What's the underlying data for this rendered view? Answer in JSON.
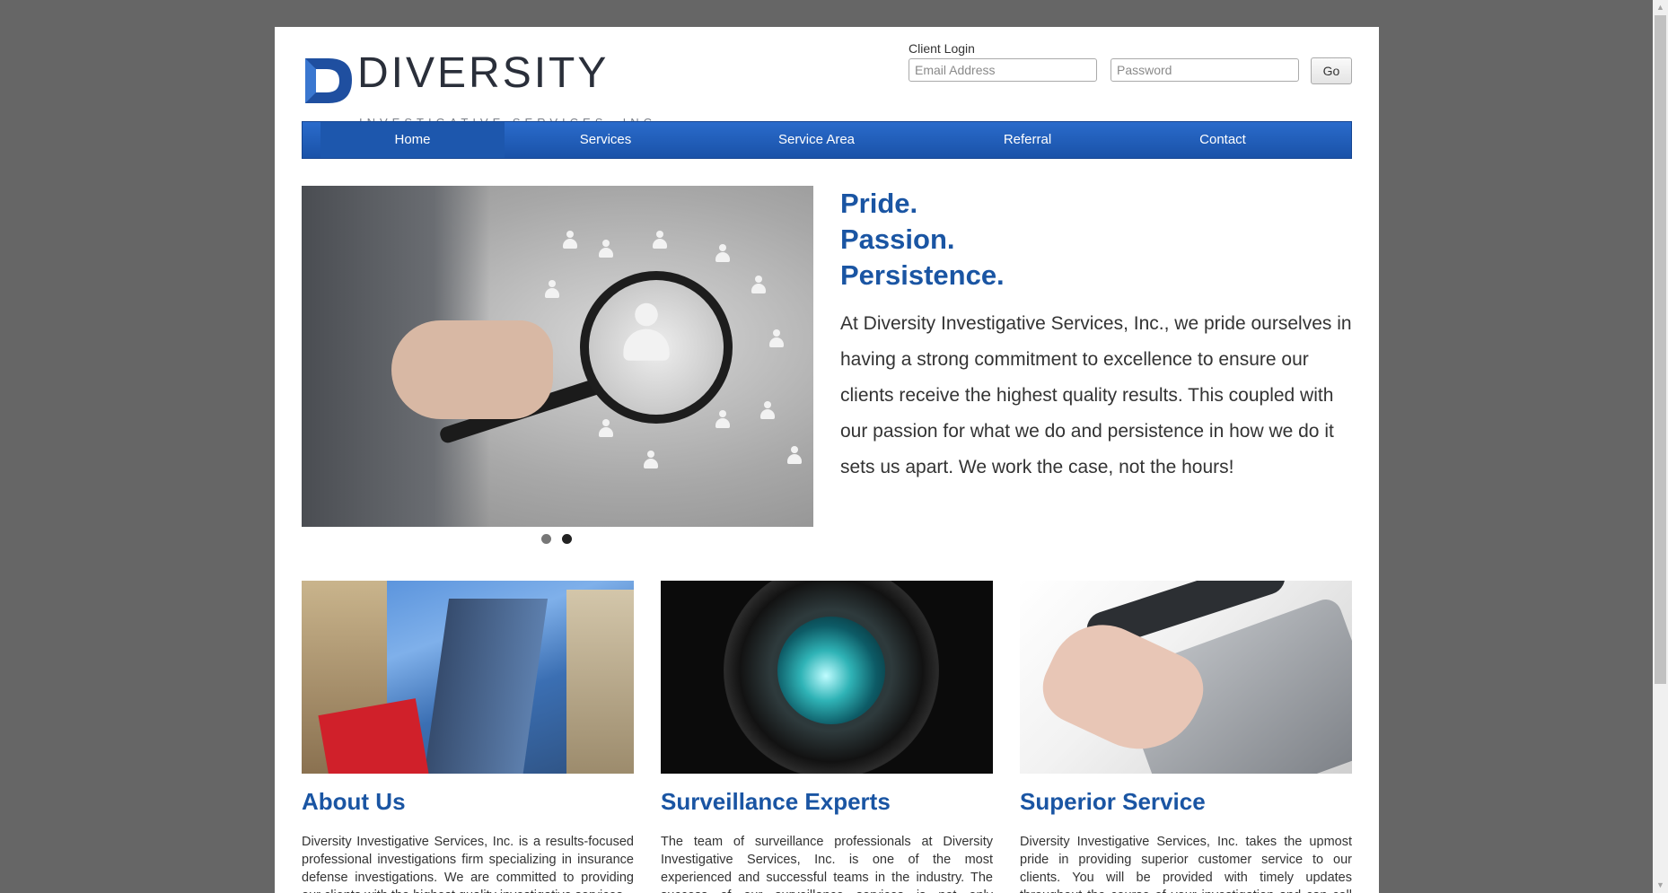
{
  "header": {
    "logo_word": "DIVERSITY",
    "logo_sub": "INVESTIGATIVE SERVICES, INC.",
    "login": {
      "label": "Client Login",
      "email_placeholder": "Email Address",
      "password_placeholder": "Password",
      "go_label": "Go"
    }
  },
  "nav": {
    "items": [
      {
        "label": "Home",
        "active": true
      },
      {
        "label": "Services",
        "active": false
      },
      {
        "label": "Service Area",
        "active": false
      },
      {
        "label": "Referral",
        "active": false
      },
      {
        "label": "Contact",
        "active": false
      }
    ]
  },
  "hero": {
    "taglines": [
      "Pride.",
      "Passion.",
      "Persistence."
    ],
    "paragraph": "At Diversity Investigative Services, Inc., we pride ourselves in having a strong commitment to excellence to ensure our clients receive the highest quality results. This coupled with our passion for what we do and persistence in how we do it sets us apart. We work the case, not the hours!",
    "slides": 2,
    "active_slide": 2
  },
  "features": [
    {
      "title": "About Us",
      "text": "Diversity Investigative Services, Inc. is a results-focused professional investigations firm specializing in insurance defense investigations. We are committed to providing our clients with the highest quality investigative services"
    },
    {
      "title": "Surveillance Experts",
      "text": "The team of surveillance professionals at Diversity Investigative Services, Inc. is one of the most experienced and successful teams in the industry. The success of our surveillance services is not only accomplished by"
    },
    {
      "title": "Superior Service",
      "text": "Diversity Investigative Services, Inc. takes the upmost pride in providing superior customer service to our clients. You will be provided with timely updates throughout the course of your investigation and can call us to assist you"
    }
  ],
  "colors": {
    "background": "#666666",
    "brand_blue": "#1a55a3",
    "nav_blue": "#2a6bcb"
  }
}
